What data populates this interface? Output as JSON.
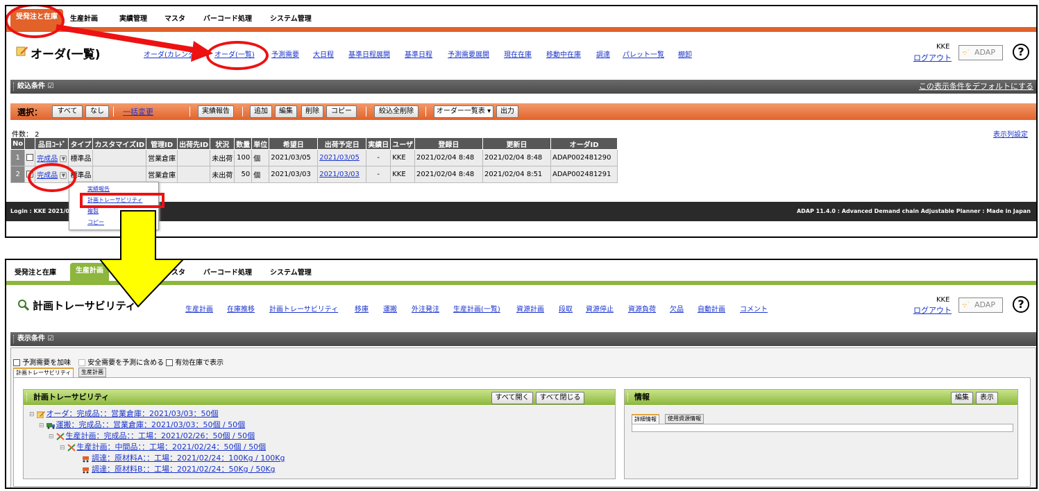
{
  "top": {
    "menu": [
      "受発注と在庫",
      "生産計画",
      "実績管理",
      "マスタ",
      "バーコード処理",
      "システム管理"
    ],
    "page_title": "オーダ(一覧)",
    "nav": [
      "オーダ(カレンダ)",
      "オーダ(一覧)",
      "予測需要",
      "大日程",
      "基準日程展開",
      "基準日程",
      "予測需要展開",
      "現在在庫",
      "移動中在庫",
      "調達",
      "パレット一覧",
      "棚卸"
    ],
    "user": "KKE",
    "logout": "ログアウト",
    "logo": "ADAP",
    "help": "?",
    "filter_bar": "絞込条件 ☑",
    "default_link": "この表示条件をデフォルトにする",
    "select_label": "選択：",
    "btn_all": "すべて",
    "btn_none": "なし",
    "bulk_change": "一括変更",
    "btn_report": "実績報告",
    "btn_add": "追加",
    "btn_edit": "編集",
    "btn_delete": "削除",
    "btn_copy": "コピー",
    "btn_clear_filter": "絞込全削除",
    "view_select": "オーダー一覧表 ▾",
    "btn_output": "出力",
    "count": "件数：  2",
    "col_settings": "表示列設定",
    "headers": [
      "No",
      "",
      "品目ｺｰﾄﾞ",
      "タイプ",
      "カスタマイズID",
      "管理ID",
      "出荷先ID",
      "状況",
      "数量",
      "単位",
      "希望日",
      "出荷予定日",
      "実績日",
      "ユーザ",
      "登録日",
      "更新日",
      "オーダID"
    ],
    "rows": [
      {
        "no": "1",
        "item": "完成品",
        "type": "標準品",
        "cust": "",
        "mgmt": "営業倉庫",
        "ship": "",
        "status": "未出荷",
        "qty": "100",
        "unit": "個",
        "want": "2021/03/05",
        "plan": "2021/03/05",
        "actual": "-",
        "user": "KKE",
        "reg": "2021/02/04 8:48",
        "upd": "2021/02/04 8:48",
        "id": "ADAP002481290"
      },
      {
        "no": "2",
        "item": "完成品",
        "type": "標準品",
        "cust": "",
        "mgmt": "営業倉庫",
        "ship": "",
        "status": "未出荷",
        "qty": "50",
        "unit": "個",
        "want": "2021/03/03",
        "plan": "2021/03/03",
        "actual": "-",
        "user": "KKE",
        "reg": "2021/02/04 8:48",
        "upd": "2021/02/04 8:51",
        "id": "ADAP002481291"
      }
    ],
    "popup": [
      "実績報告",
      "計画トレーサビリティ",
      "複製",
      "コピー"
    ],
    "footer_left": "Login : KKE 2021/02/0",
    "footer_right": "ADAP 11.4.0 : Advanced Demand chain Adjustable Planner : Made in Japan"
  },
  "bottom": {
    "menu": [
      "受発注と在庫",
      "生産計画",
      "マスタ",
      "バーコード処理",
      "システム管理"
    ],
    "page_title": "計画トレーサビリティ",
    "nav": [
      "生産計画",
      "在庫推移",
      "計画トレーサビリティ",
      "移庫",
      "運搬",
      "外注発注",
      "生産計画(一覧)",
      "資源計画",
      "段取",
      "資源停止",
      "資源負荷",
      "欠品",
      "自動計画",
      "コメント"
    ],
    "user": "KKE",
    "logout": "ログアウト",
    "logo": "ADAP",
    "help": "?",
    "cond_bar": "表示条件 ☑",
    "opt1": "予測需要を加味",
    "opt2": "安全需要を予測に含める",
    "opt3": "有効在庫で表示",
    "tab1": "計画トレーサビリティ",
    "tab2": "生産計画",
    "panel_title": "計画トレーサビリティ",
    "btn_open_all": "すべて開く",
    "btn_close_all": "すべて閉じる",
    "tree": [
      "オーダ：完成品：：営業倉庫：2021/03/03：50個",
      "運搬：完成品：：営業倉庫：2021/03/03：50個 / 50個",
      "生産計画：完成品：：工場：2021/02/26：50個 / 50個",
      "生産計画：中間品：：工場：2021/02/24：50個 / 50個",
      "調達：原材料A：：工場：2021/02/24：100Kg / 100Kg",
      "調達：原材料B：：工場：2021/02/24：50Kg / 50Kg"
    ],
    "info_title": "情報",
    "btn_edit": "編集",
    "btn_show": "表示",
    "info_tab1": "詳細情報",
    "info_tab2": "使用資源情報"
  },
  "colors": {
    "orange": "#e2622a",
    "green": "#8cb63c",
    "link": "#1a33cc",
    "annotation_red": "#ee1111",
    "arrow_yellow": "#ffff00"
  }
}
